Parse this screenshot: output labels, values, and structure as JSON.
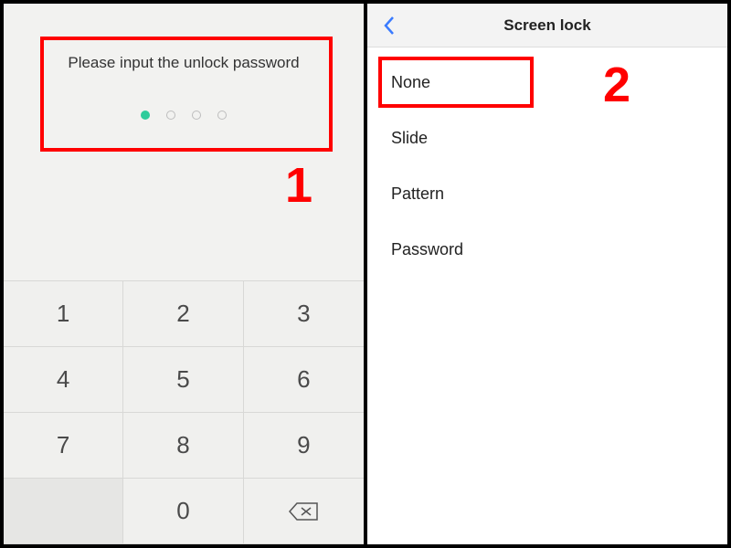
{
  "left": {
    "prompt": "Please input the unlock password",
    "pin_length": 4,
    "pin_entered": 1,
    "keypad": {
      "k1": "1",
      "k2": "2",
      "k3": "3",
      "k4": "4",
      "k5": "5",
      "k6": "6",
      "k7": "7",
      "k8": "8",
      "k9": "9",
      "k0": "0"
    }
  },
  "right": {
    "title": "Screen lock",
    "options": {
      "o0": "None",
      "o1": "Slide",
      "o2": "Pattern",
      "o3": "Password"
    }
  },
  "annotations": {
    "n1": "1",
    "n2": "2"
  }
}
